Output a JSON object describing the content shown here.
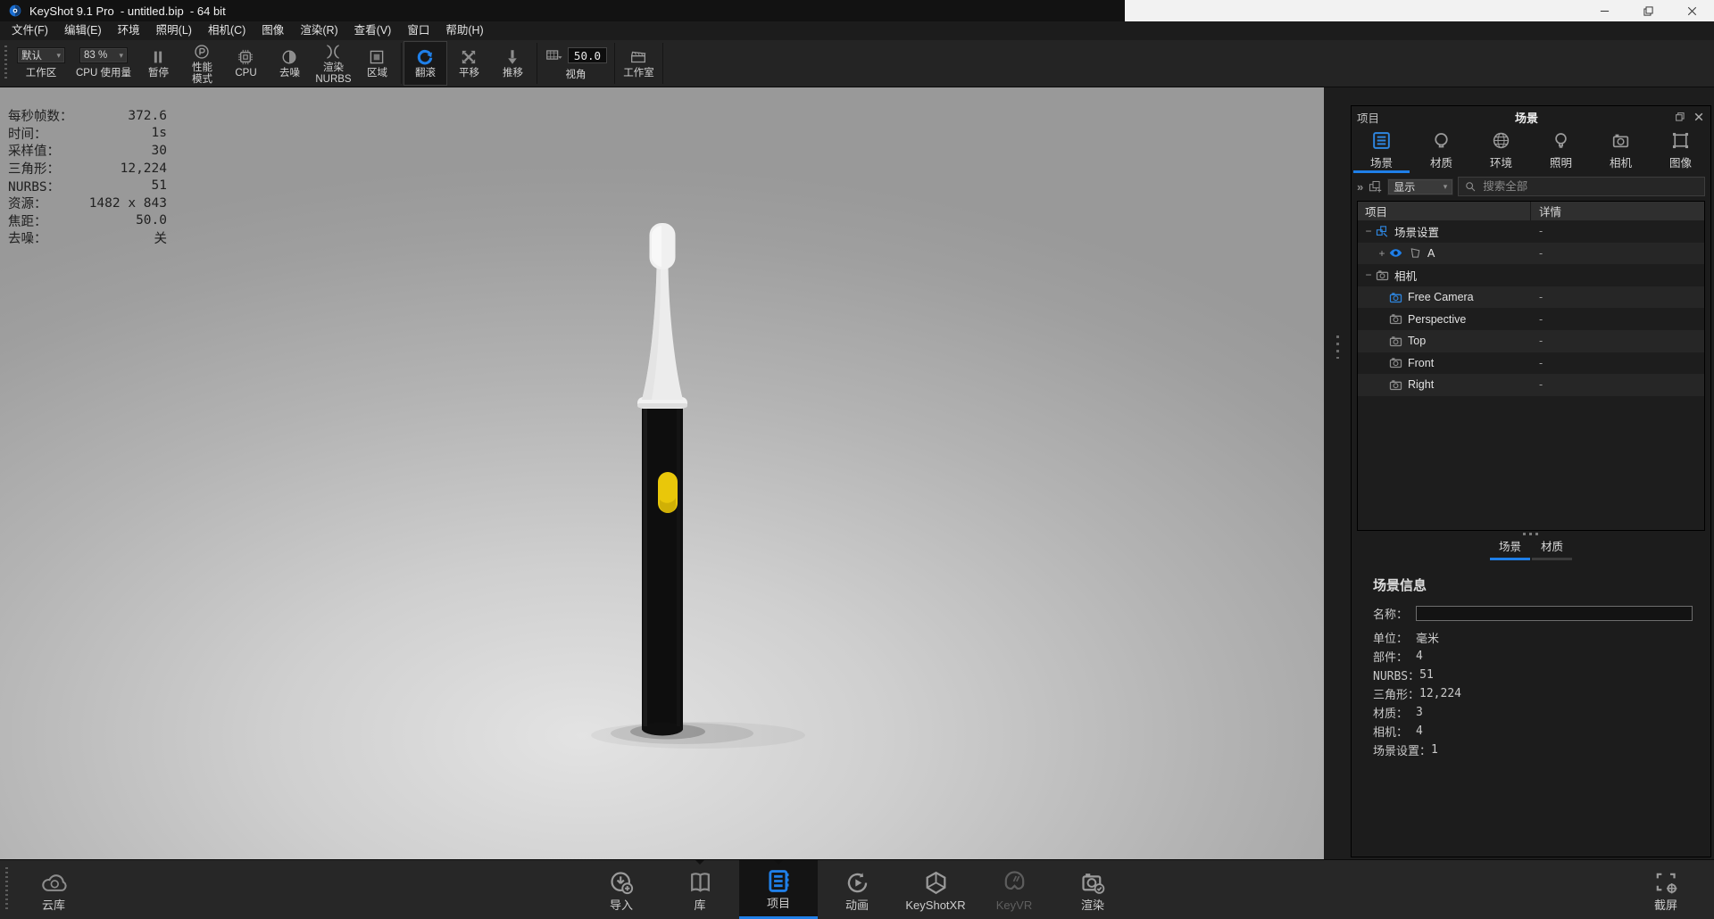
{
  "window": {
    "title": "KeyShot 9.1 Pro  - untitled.bip  - 64 bit"
  },
  "menu": {
    "items": [
      "文件(F)",
      "编辑(E)",
      "环境",
      "照明(L)",
      "相机(C)",
      "图像",
      "渲染(R)",
      "查看(V)",
      "窗口",
      "帮助(H)"
    ]
  },
  "toolbar": {
    "workspace": {
      "dropdown": "默认",
      "label": "工作区"
    },
    "cpu_usage": {
      "dropdown": "83 %",
      "label": "CPU 使用量"
    },
    "buttons": [
      {
        "icon": "pause-icon",
        "label": "暂停"
      },
      {
        "icon": "performance-icon",
        "label": "性能\n模式"
      },
      {
        "icon": "cpu-icon",
        "label": "CPU"
      },
      {
        "icon": "denoise-icon",
        "label": "去噪"
      },
      {
        "icon": "nurbs-icon",
        "label": "渲染\nNURBS"
      },
      {
        "icon": "region-icon",
        "label": "区域"
      }
    ],
    "camera_buttons": [
      {
        "icon": "tumble-icon",
        "label": "翻滚",
        "active": true
      },
      {
        "icon": "pan-icon",
        "label": "平移"
      },
      {
        "icon": "dolly-icon",
        "label": "推移"
      }
    ],
    "fov": {
      "icon": "fov-icon",
      "value": "50.0",
      "label": "视角"
    },
    "studio": {
      "icon": "studio-icon",
      "label": "工作室"
    }
  },
  "viewport": {
    "stats": [
      {
        "label": "每秒帧数：",
        "value": "372.6"
      },
      {
        "label": "时间：",
        "value": "1s"
      },
      {
        "label": "采样值：",
        "value": "30"
      },
      {
        "label": "三角形：",
        "value": "12,224"
      },
      {
        "label": "NURBS：",
        "value": "51"
      },
      {
        "label": "资源：",
        "value": "1482 x 843"
      },
      {
        "label": "焦距：",
        "value": "50.0"
      },
      {
        "label": "去噪：",
        "value": "关"
      }
    ],
    "model": {
      "name": "electric-toothbrush",
      "body_color": "#0e0e0e",
      "head_color": "#efefef",
      "button_color": "#e9c70a"
    }
  },
  "project_panel": {
    "dock_title": "项目",
    "title": "场景",
    "tabs": [
      {
        "label": "场景",
        "icon": "scene-tab-icon",
        "active": true
      },
      {
        "label": "材质",
        "icon": "material-tab-icon"
      },
      {
        "label": "环境",
        "icon": "environment-tab-icon"
      },
      {
        "label": "照明",
        "icon": "lighting-tab-icon"
      },
      {
        "label": "相机",
        "icon": "camera-tab-icon"
      },
      {
        "label": "图像",
        "icon": "image-tab-icon"
      }
    ],
    "filter": {
      "chevrons": "»",
      "show_button": "显示",
      "search_placeholder": "搜索全部"
    },
    "tree": {
      "columns": [
        "项目",
        "详情"
      ],
      "rows": [
        {
          "label": "场景设置",
          "detail": "-",
          "level": 0,
          "expander": "−",
          "icon": "scene-settings-icon"
        },
        {
          "label": "A",
          "detail": "-",
          "level": 1,
          "expander": "+",
          "icon": "model-icon",
          "eye": true
        },
        {
          "label": "相机",
          "detail": "",
          "level": 0,
          "expander": "−",
          "icon": "camera-gray-icon"
        },
        {
          "label": "Free Camera",
          "detail": "-",
          "level": 1,
          "expander": "",
          "icon": "camera-blue-icon"
        },
        {
          "label": "Perspective",
          "detail": "-",
          "level": 1,
          "expander": "",
          "icon": "camera-gray-icon"
        },
        {
          "label": "Top",
          "detail": "-",
          "level": 1,
          "expander": "",
          "icon": "camera-gray-icon"
        },
        {
          "label": "Front",
          "detail": "-",
          "level": 1,
          "expander": "",
          "icon": "camera-gray-icon"
        },
        {
          "label": "Right",
          "detail": "-",
          "level": 1,
          "expander": "",
          "icon": "camera-gray-icon"
        }
      ]
    },
    "bottom_tabs": [
      {
        "label": "场景",
        "active": true
      },
      {
        "label": "材质",
        "active": false
      }
    ],
    "scene_info": {
      "heading": "场景信息",
      "name_label": "名称：",
      "name_value": "",
      "rows": [
        {
          "label": "单位：",
          "value": "毫米"
        },
        {
          "label": "部件：",
          "value": "4"
        },
        {
          "label": "NURBS：",
          "value": "51"
        },
        {
          "label": "三角形：",
          "value": "12,224"
        },
        {
          "label": "材质：",
          "value": "3"
        },
        {
          "label": "相机：",
          "value": "4"
        },
        {
          "label": "场景设置：",
          "value": "1"
        }
      ]
    }
  },
  "bottom_bar": {
    "left": [
      {
        "icon": "cloud-icon",
        "label": "云库"
      }
    ],
    "center": [
      {
        "icon": "import-icon",
        "label": "导入"
      },
      {
        "icon": "library-icon",
        "label": "库",
        "notch": true
      },
      {
        "icon": "project-icon",
        "label": "项目",
        "active": true,
        "notch": true
      },
      {
        "icon": "animation-icon",
        "label": "动画"
      },
      {
        "icon": "keyshotxr-icon",
        "label": "KeyShotXR"
      },
      {
        "icon": "keyvr-icon",
        "label": "KeyVR",
        "disabled": true
      },
      {
        "icon": "render-icon",
        "label": "渲染"
      }
    ],
    "right": [
      {
        "icon": "screenshot-icon",
        "label": "截屏"
      }
    ]
  },
  "colors": {
    "accent": "#1f7fe8",
    "accent_icon": "#2e86e0",
    "selection_underline": "#1f7fe8",
    "button_yellow": "#e9c70a"
  }
}
